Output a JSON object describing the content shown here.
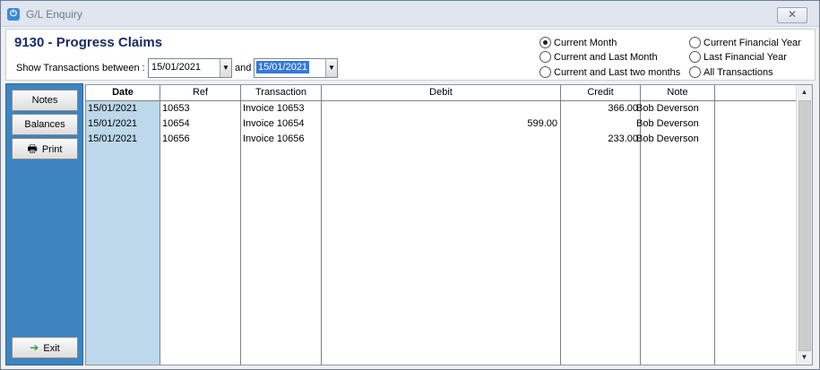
{
  "window": {
    "title": "G/L Enquiry",
    "close_label": "✕"
  },
  "header": {
    "account_title": "9130 - Progress Claims",
    "show_label": "Show Transactions between :",
    "from_date": "15/01/2021",
    "and_label": "and",
    "to_date": "15/01/2021"
  },
  "period_options": [
    {
      "label": "Current Month",
      "checked": true
    },
    {
      "label": "Current and Last Month",
      "checked": false
    },
    {
      "label": "Current and Last two months",
      "checked": false
    },
    {
      "label": "Current Financial Year",
      "checked": false
    },
    {
      "label": "Last Financial Year",
      "checked": false
    },
    {
      "label": "All Transactions",
      "checked": false
    }
  ],
  "sidebar": {
    "notes_label": "Notes",
    "balances_label": "Balances",
    "print_label": "Print",
    "exit_label": "Exit"
  },
  "table": {
    "columns": [
      "Date",
      "Ref",
      "Transaction",
      "Debit",
      "Credit",
      "Note"
    ],
    "rows": [
      {
        "date": "15/01/2021",
        "ref": "10653",
        "transaction": "Invoice 10653",
        "debit": "",
        "credit": "366.00",
        "note": "Bob Deverson"
      },
      {
        "date": "15/01/2021",
        "ref": "10654",
        "transaction": "Invoice 10654",
        "debit": "599.00",
        "credit": "",
        "note": "Bob Deverson"
      },
      {
        "date": "15/01/2021",
        "ref": "10656",
        "transaction": "Invoice 10656",
        "debit": "",
        "credit": "233.00",
        "note": "Bob Deverson"
      }
    ]
  },
  "colors": {
    "sidebar": "#3d84c0",
    "date_column": "#bcd8ea",
    "title_text": "#1a2a63",
    "selection": "#3478d8"
  }
}
